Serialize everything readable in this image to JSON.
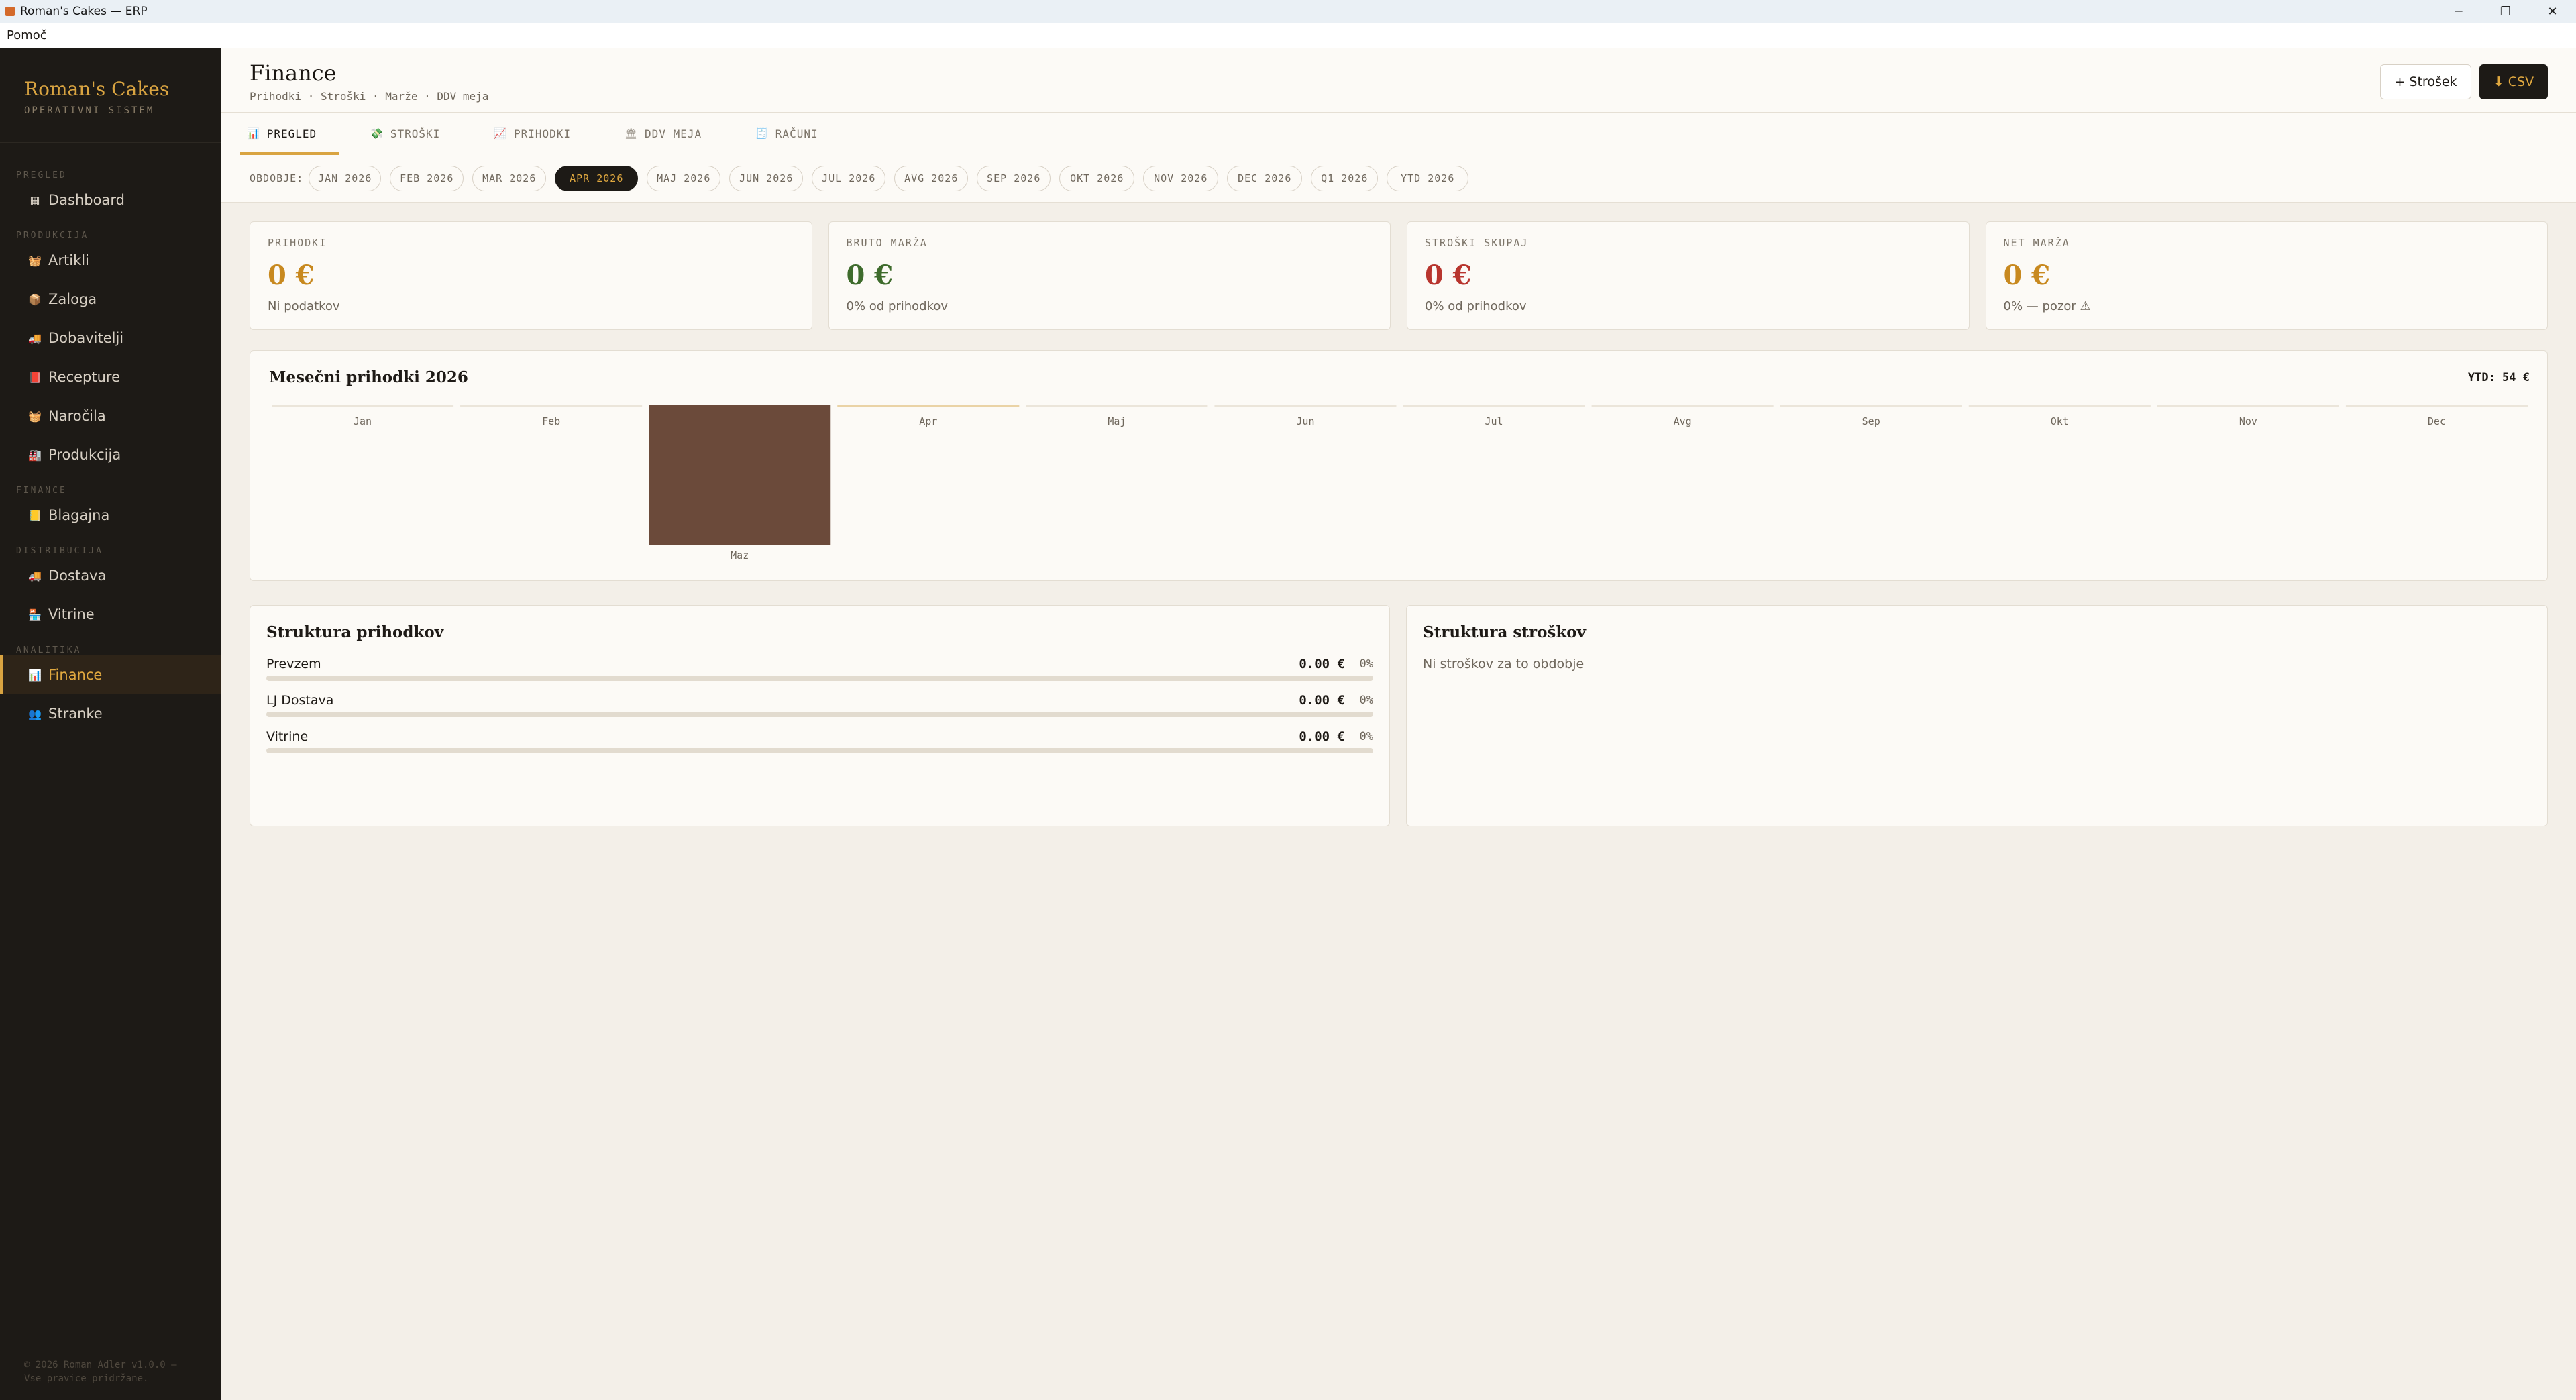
{
  "window": {
    "title": "Roman's Cakes — ERP"
  },
  "menu": {
    "help": "Pomoč"
  },
  "brand": {
    "name": "Roman's Cakes",
    "subtitle": "OPERATIVNI SISTEM"
  },
  "sidebar": {
    "sections": [
      {
        "label": "PREGLED",
        "items": [
          {
            "label": "Dashboard",
            "icon": "dashboard-icon",
            "glyph": "▦"
          }
        ]
      },
      {
        "label": "PRODUKCIJA",
        "items": [
          {
            "label": "Artikli",
            "icon": "basket-icon",
            "glyph": "🧺"
          },
          {
            "label": "Zaloga",
            "icon": "box-icon",
            "glyph": "📦"
          },
          {
            "label": "Dobavitelji",
            "icon": "truck-icon",
            "glyph": "🚚"
          },
          {
            "label": "Recepture",
            "icon": "book-icon",
            "glyph": "📕"
          },
          {
            "label": "Naročila",
            "icon": "basket-icon",
            "glyph": "🧺"
          },
          {
            "label": "Produkcija",
            "icon": "factory-icon",
            "glyph": "🏭"
          }
        ]
      },
      {
        "label": "FINANCE",
        "items": [
          {
            "label": "Blagajna",
            "icon": "ledger-icon",
            "glyph": "📒"
          }
        ]
      },
      {
        "label": "DISTRIBUCIJA",
        "items": [
          {
            "label": "Dostava",
            "icon": "delivery-truck-icon",
            "glyph": "🚚"
          },
          {
            "label": "Vitrine",
            "icon": "shop-icon",
            "glyph": "🏪"
          }
        ]
      },
      {
        "label": "ANALITIKA",
        "items": [
          {
            "label": "Finance",
            "icon": "bar-chart-icon",
            "glyph": "📊",
            "active": true
          },
          {
            "label": "Stranke",
            "icon": "users-icon",
            "glyph": "👥"
          }
        ]
      }
    ],
    "footer": "© 2026 Roman Adler v1.0.0 — Vse pravice pridržane."
  },
  "header": {
    "title": "Finance",
    "subtitle": "Prihodki · Stroški · Marže · DDV meja",
    "add_cost_label": "+ Strošek",
    "csv_label": "⬇ CSV"
  },
  "tabs": [
    {
      "label": "PREGLED",
      "icon": "chart-icon",
      "glyph": "📊",
      "active": true
    },
    {
      "label": "STROŠKI",
      "icon": "money-icon",
      "glyph": "💸"
    },
    {
      "label": "PRIHODKI",
      "icon": "trend-icon",
      "glyph": "📈"
    },
    {
      "label": "DDV MEJA",
      "icon": "bank-icon",
      "glyph": "🏛"
    },
    {
      "label": "RAČUNI",
      "icon": "receipt-icon",
      "glyph": "🧾"
    }
  ],
  "periods": {
    "label": "OBDOBJE:",
    "options": [
      "JAN 2026",
      "FEB 2026",
      "MAR 2026",
      "APR 2026",
      "MAJ 2026",
      "JUN 2026",
      "JUL 2026",
      "AVG 2026",
      "SEP 2026",
      "OKT 2026",
      "NOV 2026",
      "DEC 2026",
      "Q1 2026",
      "YTD 2026"
    ],
    "selected": "APR 2026"
  },
  "kpis": [
    {
      "label": "PRIHODKI",
      "value": "0 €",
      "sub": "Ni podatkov",
      "color": "#c8891f"
    },
    {
      "label": "BRUTO MARŽA",
      "value": "0 €",
      "sub": "0% od prihodkov",
      "color": "#3e6b2c"
    },
    {
      "label": "STROŠKI SKUPAJ",
      "value": "0 €",
      "sub": "0% od prihodkov",
      "color": "#b8352e"
    },
    {
      "label": "NET MARŽA",
      "value": "0 €",
      "sub": "0% — pozor ⚠",
      "color": "#c8891f"
    }
  ],
  "chart_data": {
    "type": "bar",
    "title": "Mesečni prihodki 2026",
    "ytd_label": "YTD: 54 €",
    "categories": [
      "Jan",
      "Feb",
      "Maz",
      "Apr",
      "Maj",
      "Jun",
      "Jul",
      "Avg",
      "Sep",
      "Okt",
      "Nov",
      "Dec"
    ],
    "values": [
      0,
      0,
      54,
      0,
      0,
      0,
      0,
      0,
      0,
      0,
      0,
      0
    ],
    "highlight": "Apr",
    "bar_color": "#6b4a3a",
    "highlight_color": "#ead3a6"
  },
  "revenue_structure": {
    "title": "Struktura prihodkov",
    "rows": [
      {
        "name": "Prevzem",
        "value": "0.00 €",
        "pct": "0%",
        "fraction": 0
      },
      {
        "name": "LJ Dostava",
        "value": "0.00 €",
        "pct": "0%",
        "fraction": 0
      },
      {
        "name": "Vitrine",
        "value": "0.00 €",
        "pct": "0%",
        "fraction": 0
      }
    ]
  },
  "cost_structure": {
    "title": "Struktura stroškov",
    "empty": "Ni stroškov za to obdobje"
  }
}
